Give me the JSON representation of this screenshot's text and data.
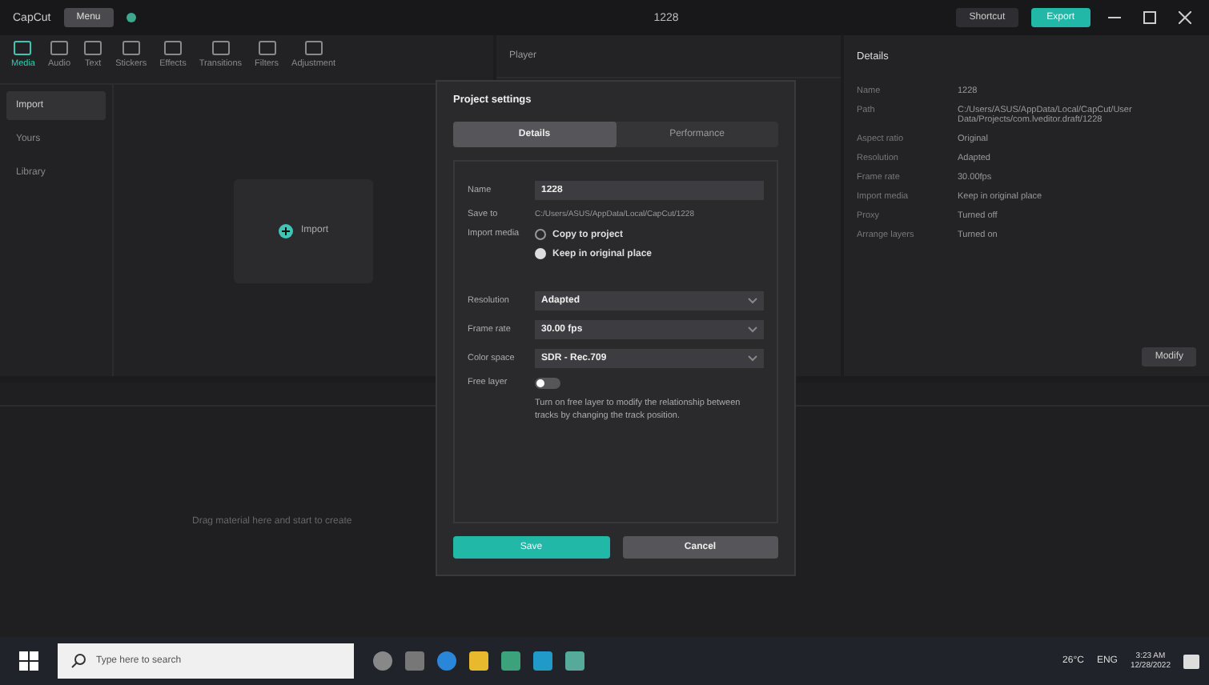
{
  "titlebar": {
    "app_name": "CapCut",
    "menu": "Menu",
    "project": "1228",
    "shortcut": "Shortcut",
    "export": "Export"
  },
  "toolbar": [
    {
      "label": "Media",
      "selected": true
    },
    {
      "label": "Audio",
      "selected": false
    },
    {
      "label": "Text",
      "selected": false
    },
    {
      "label": "Stickers",
      "selected": false
    },
    {
      "label": "Effects",
      "selected": false
    },
    {
      "label": "Transitions",
      "selected": false
    },
    {
      "label": "Filters",
      "selected": false
    },
    {
      "label": "Adjustment",
      "selected": false
    }
  ],
  "sidebar": {
    "items": [
      {
        "label": "Import",
        "selected": true
      },
      {
        "label": "Yours",
        "selected": false
      },
      {
        "label": "Library",
        "selected": false
      }
    ]
  },
  "import_button": "Import",
  "player": {
    "title": "Player"
  },
  "details": {
    "title": "Details",
    "rows": [
      {
        "label": "Name",
        "value": "1228"
      },
      {
        "label": "Path",
        "value": "C:/Users/ASUS/AppData/Local/CapCut/User Data/Projects/com.lveditor.draft/1228"
      },
      {
        "label": "Aspect ratio",
        "value": "Original"
      },
      {
        "label": "Resolution",
        "value": "Adapted"
      },
      {
        "label": "Frame rate",
        "value": "30.00fps"
      },
      {
        "label": "Import media",
        "value": "Keep in original place"
      },
      {
        "label": "Proxy",
        "value": "Turned off"
      },
      {
        "label": "Arrange layers",
        "value": "Turned on"
      }
    ],
    "modify": "Modify"
  },
  "timeline": {
    "hint": "Drag material here and start to create"
  },
  "dialog": {
    "title": "Project settings",
    "tabs": [
      {
        "label": "Details",
        "selected": true
      },
      {
        "label": "Performance",
        "selected": false
      }
    ],
    "name_label": "Name",
    "name_value": "1228",
    "save_label": "Save to",
    "save_value": "C:/Users/ASUS/AppData/Local/CapCut/1228",
    "import_label": "Import media",
    "import_options": [
      {
        "label": "Copy to project",
        "selected": false
      },
      {
        "label": "Keep in original place",
        "selected": true
      }
    ],
    "selects": [
      {
        "label": "Resolution",
        "value": "Adapted"
      },
      {
        "label": "Frame rate",
        "value": "30.00 fps"
      },
      {
        "label": "Color space",
        "value": "SDR - Rec.709"
      }
    ],
    "free_layer_label": "Free layer",
    "free_layer_on": false,
    "free_layer_note": "Turn on free layer to modify the relationship between tracks by changing the track position.",
    "buttons": [
      {
        "label": "Save",
        "kind": "primary"
      },
      {
        "label": "Cancel",
        "kind": "secondary"
      }
    ]
  },
  "taskbar": {
    "search_placeholder": "Type here to search",
    "weather": "26°C",
    "lang": "ENG",
    "time": "3:23 AM",
    "date": "12/28/2022"
  }
}
